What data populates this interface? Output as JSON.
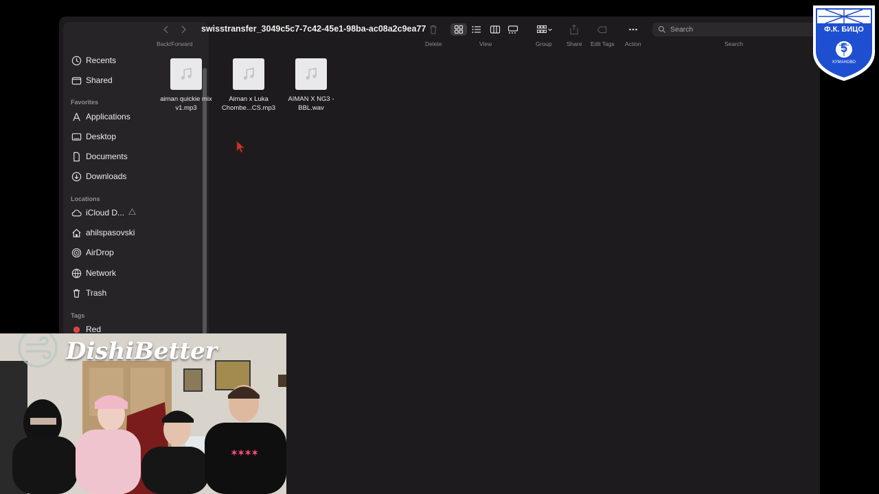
{
  "finder": {
    "path_title": "swisstransfer_3049c5c7-7c42-45e1-98ba-ac08a2c9ea77",
    "toolbar": {
      "back_forward_label": "Back/Forward",
      "delete_label": "Delete",
      "view_label": "View",
      "group_label": "Group",
      "share_label": "Share",
      "edit_tags_label": "Edit Tags",
      "action_label": "Action",
      "search_label": "Search",
      "search_placeholder": "Search"
    },
    "sidebar": {
      "top_items": [
        {
          "label": "Recents",
          "icon": "clock-icon"
        },
        {
          "label": "Shared",
          "icon": "shared-folder-icon"
        }
      ],
      "favorites_header": "Favorites",
      "favorites": [
        {
          "label": "Applications",
          "icon": "applications-icon"
        },
        {
          "label": "Desktop",
          "icon": "desktop-icon"
        },
        {
          "label": "Documents",
          "icon": "document-icon"
        },
        {
          "label": "Downloads",
          "icon": "download-icon"
        }
      ],
      "locations_header": "Locations",
      "locations": [
        {
          "label": "iCloud D...",
          "icon": "cloud-icon"
        },
        {
          "label": "ahilspasovski",
          "icon": "home-icon"
        },
        {
          "label": "AirDrop",
          "icon": "airdrop-icon"
        },
        {
          "label": "Network",
          "icon": "network-icon"
        },
        {
          "label": "Trash",
          "icon": "trash-icon"
        }
      ],
      "tags_header": "Tags",
      "tags": [
        {
          "label": "Red",
          "color": "#e0443e"
        }
      ]
    },
    "files": [
      {
        "name_line1": "aiman quickie mix",
        "name_line2": "v1.mp3"
      },
      {
        "name_line1": "Aiman x Luka",
        "name_line2": "Chombe...CS.mp3"
      },
      {
        "name_line1": "AIMAN X NG3 -",
        "name_line2": "BBL.wav"
      }
    ]
  },
  "overlay": {
    "streamer_name": "DishiBetter",
    "club_logo": {
      "text": "Ф.К. БИЦО",
      "number": "5",
      "city": "КУМАНОВО",
      "color": "#1e4fd1"
    }
  }
}
